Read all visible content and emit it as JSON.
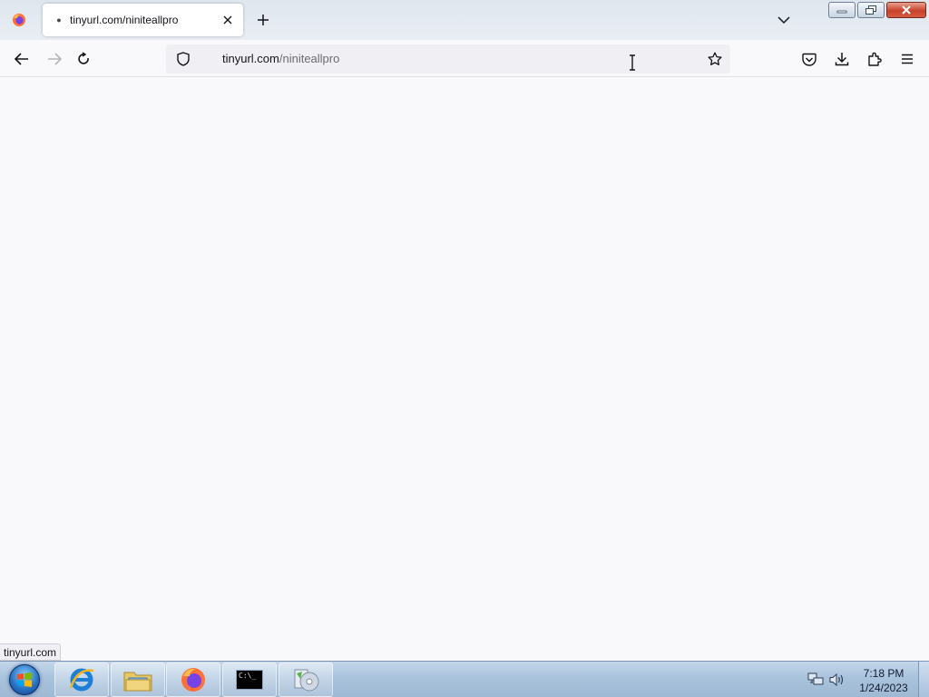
{
  "browser": {
    "tab": {
      "title": "tinyurl.com/niniteallpro",
      "close_icon": "close-icon",
      "favicon": "loading-dot-icon"
    },
    "newtab_icon": "plus-icon",
    "tablist_icon": "chevron-down-icon",
    "window_controls": [
      "minimize-icon",
      "restore-icon",
      "close-icon"
    ],
    "nav": {
      "back_icon": "arrow-left-icon",
      "forward_icon": "arrow-right-icon",
      "reload_icon": "reload-icon"
    },
    "urlbar": {
      "domain": "tinyurl.com",
      "path": "/niniteallpro",
      "shield_icon": "shield-icon",
      "star_icon": "star-icon"
    },
    "toolbar_icons": [
      "pocket-icon",
      "download-icon",
      "extensions-icon",
      "hamburger-menu-icon"
    ],
    "status": "tinyurl.com"
  },
  "taskbar": {
    "start_icon": "windows-start-icon",
    "apps": [
      {
        "name": "internet-explorer-icon"
      },
      {
        "name": "file-explorer-icon"
      },
      {
        "name": "firefox-icon"
      },
      {
        "name": "command-prompt-icon"
      },
      {
        "name": "media-app-icon"
      }
    ],
    "cmd_label": "C:\\_",
    "tray_icons": [
      "network-icon",
      "volume-icon"
    ],
    "clock": {
      "time": "7:18 PM",
      "date": "1/24/2023"
    }
  },
  "colors": {
    "content_bg": "#f9f9fb",
    "urlbar_bg": "#f0f0f4",
    "taskbar": "#a9c3dd",
    "firefox_orange": "#ff7139",
    "firefox_purple": "#7542e5"
  }
}
